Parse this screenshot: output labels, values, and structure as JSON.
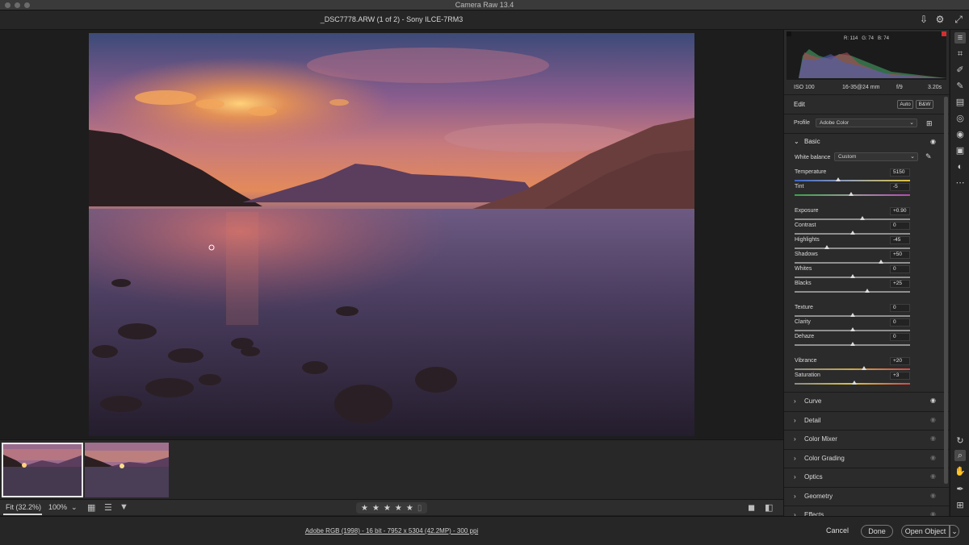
{
  "window": {
    "title": "Camera Raw 13.4"
  },
  "file_header": {
    "text": "_DSC7778.ARW (1 of 2)  -  Sony ILCE-7RM3"
  },
  "histogram": {
    "r": "R: 114",
    "g": "G: 74",
    "b": "B: 74"
  },
  "camera_info": {
    "iso": "ISO 100",
    "lens": "16-35@24 mm",
    "aperture": "f/9",
    "shutter": "3.20s"
  },
  "edit": {
    "title": "Edit",
    "auto_label": "Auto",
    "bw_label": "B&W",
    "profile_label": "Profile",
    "profile_value": "Adobe Color"
  },
  "basic": {
    "title": "Basic",
    "wb_label": "White balance",
    "wb_value": "Custom",
    "sliders": [
      {
        "label": "Temperature",
        "value": "5150",
        "pos": 0.38,
        "track": "temp"
      },
      {
        "label": "Tint",
        "value": "-5",
        "pos": 0.49,
        "track": "tint"
      },
      {
        "label": "Exposure",
        "value": "+0.90",
        "pos": 0.59,
        "track": "plain"
      },
      {
        "label": "Contrast",
        "value": "0",
        "pos": 0.5,
        "track": "plain"
      },
      {
        "label": "Highlights",
        "value": "-45",
        "pos": 0.28,
        "track": "plain"
      },
      {
        "label": "Shadows",
        "value": "+50",
        "pos": 0.75,
        "track": "plain"
      },
      {
        "label": "Whites",
        "value": "0",
        "pos": 0.5,
        "track": "plain"
      },
      {
        "label": "Blacks",
        "value": "+25",
        "pos": 0.63,
        "track": "plain"
      },
      {
        "label": "Texture",
        "value": "0",
        "pos": 0.5,
        "track": "plain"
      },
      {
        "label": "Clarity",
        "value": "0",
        "pos": 0.5,
        "track": "plain"
      },
      {
        "label": "Dehaze",
        "value": "0",
        "pos": 0.5,
        "track": "plain"
      },
      {
        "label": "Vibrance",
        "value": "+20",
        "pos": 0.6,
        "track": "vib"
      },
      {
        "label": "Saturation",
        "value": "+3",
        "pos": 0.52,
        "track": "sat"
      }
    ]
  },
  "sections": [
    "Curve",
    "Detail",
    "Color Mixer",
    "Color Grading",
    "Optics",
    "Geometry",
    "Effects"
  ],
  "toolbar": {
    "fit_label": "Fit (32.2%)",
    "zoom_label": "100%"
  },
  "status": {
    "metadata": "Adobe RGB (1998) - 16 bit - 7952 x 5304 (42.2MP) - 300 ppi"
  },
  "buttons": {
    "cancel": "Cancel",
    "done": "Done",
    "open": "Open Object"
  },
  "colors": {
    "panel_bg": "#2b2b2b",
    "canvas_bg": "#1d1d1d",
    "accent": "#dcdcdc"
  }
}
